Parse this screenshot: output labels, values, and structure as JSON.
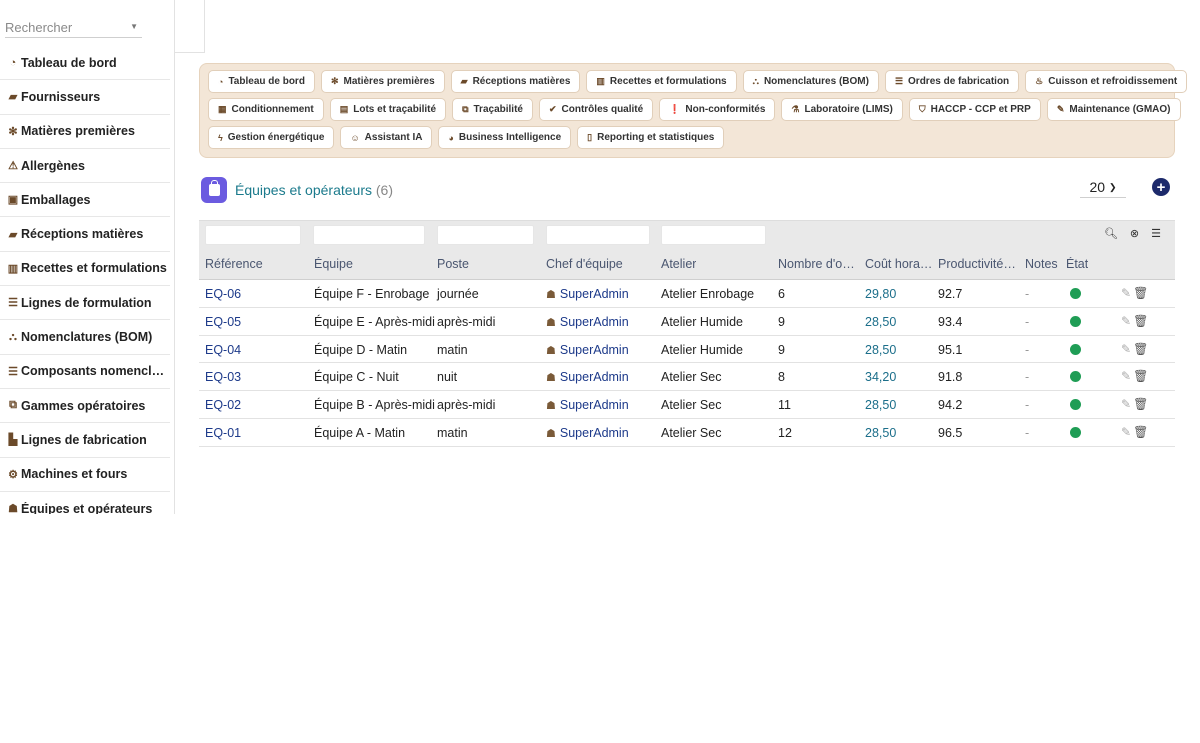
{
  "search": {
    "placeholder": "Rechercher"
  },
  "sidebar": {
    "items": [
      {
        "label": "Tableau de bord",
        "icon": "gauge-icon",
        "glyph": "◔"
      },
      {
        "label": "Fournisseurs",
        "icon": "truck-icon",
        "glyph": "▰"
      },
      {
        "label": "Matières premières",
        "icon": "seedling-icon",
        "glyph": "✻"
      },
      {
        "label": "Allergènes",
        "icon": "warning-icon",
        "glyph": "⚠"
      },
      {
        "label": "Emballages",
        "icon": "box-icon",
        "glyph": "▣"
      },
      {
        "label": "Réceptions matières",
        "icon": "truck-loading-icon",
        "glyph": "▰"
      },
      {
        "label": "Recettes et formulations",
        "icon": "book-icon",
        "glyph": "▥"
      },
      {
        "label": "Lignes de formulation",
        "icon": "list-icon",
        "glyph": "☰"
      },
      {
        "label": "Nomenclatures (BOM)",
        "icon": "sitemap-icon",
        "glyph": "⛬"
      },
      {
        "label": "Composants nomenclature",
        "icon": "list-icon",
        "glyph": "☰"
      },
      {
        "label": "Gammes opératoires",
        "icon": "project-diagram-icon",
        "glyph": "⧉"
      },
      {
        "label": "Lignes de fabrication",
        "icon": "industry-icon",
        "glyph": "▙"
      },
      {
        "label": "Machines et fours",
        "icon": "cogs-icon",
        "glyph": "⚙"
      },
      {
        "label": "Équipes et opérateurs",
        "icon": "users-icon",
        "glyph": "☗"
      }
    ]
  },
  "modules": {
    "rows": [
      [
        {
          "label": "Tableau de bord",
          "icon": "gauge-icon",
          "glyph": "◔"
        },
        {
          "label": "Matières premières",
          "icon": "seedling-icon",
          "glyph": "✻"
        },
        {
          "label": "Réceptions matières",
          "icon": "truck-loading-icon",
          "glyph": "▰"
        },
        {
          "label": "Recettes et formulations",
          "icon": "book-icon",
          "glyph": "▥"
        },
        {
          "label": "Nomenclatures (BOM)",
          "icon": "sitemap-icon",
          "glyph": "⛬"
        },
        {
          "label": "Ordres de fabrication",
          "icon": "list-icon",
          "glyph": "☰"
        },
        {
          "label": "Cuisson et refroidissement",
          "icon": "fire-icon",
          "glyph": "♨"
        }
      ],
      [
        {
          "label": "Conditionnement",
          "icon": "boxes-icon",
          "glyph": "▦"
        },
        {
          "label": "Lots et traçabilité",
          "icon": "barcode-icon",
          "glyph": "▤"
        },
        {
          "label": "Traçabilité",
          "icon": "project-diagram-icon",
          "glyph": "⧉"
        },
        {
          "label": "Contrôles qualité",
          "icon": "check-circle-icon",
          "glyph": "✔"
        },
        {
          "label": "Non-conformités",
          "icon": "exclamation-circle-icon",
          "glyph": "❗"
        },
        {
          "label": "Laboratoire (LIMS)",
          "icon": "flask-icon",
          "glyph": "⚗"
        },
        {
          "label": "HACCP - CCP et PRP",
          "icon": "shield-icon",
          "glyph": "⛉"
        },
        {
          "label": "Maintenance (GMAO)",
          "icon": "wrench-icon",
          "glyph": "✎"
        }
      ],
      [
        {
          "label": "Gestion énergétique",
          "icon": "bolt-icon",
          "glyph": "ϟ"
        },
        {
          "label": "Assistant IA",
          "icon": "robot-icon",
          "glyph": "☺"
        },
        {
          "label": "Business Intelligence",
          "icon": "chart-pie-icon",
          "glyph": "◕"
        },
        {
          "label": "Reporting et statistiques",
          "icon": "file-icon",
          "glyph": "▯"
        }
      ]
    ]
  },
  "page": {
    "title": "Équipes et opérateurs",
    "count": "(6)",
    "per_page": "20"
  },
  "table": {
    "columns": [
      "Référence",
      "Équipe",
      "Poste",
      "Chef d'équipe",
      "Atelier",
      "Nombre d'opérateurs",
      "Coût horaire",
      "Productivité cible",
      "Notes",
      "État"
    ],
    "rows": [
      {
        "ref": "EQ-06",
        "team": "Équipe F - Enrobage",
        "shift": "journée",
        "chief": "SuperAdmin",
        "workshop": "Atelier Enrobage",
        "operators": "6",
        "cost": "29,80",
        "productivity": "92.7",
        "notes": "-"
      },
      {
        "ref": "EQ-05",
        "team": "Équipe E - Après-midi",
        "shift": "après-midi",
        "chief": "SuperAdmin",
        "workshop": "Atelier Humide",
        "operators": "9",
        "cost": "28,50",
        "productivity": "93.4",
        "notes": "-"
      },
      {
        "ref": "EQ-04",
        "team": "Équipe D - Matin",
        "shift": "matin",
        "chief": "SuperAdmin",
        "workshop": "Atelier Humide",
        "operators": "9",
        "cost": "28,50",
        "productivity": "95.1",
        "notes": "-"
      },
      {
        "ref": "EQ-03",
        "team": "Équipe C - Nuit",
        "shift": "nuit",
        "chief": "SuperAdmin",
        "workshop": "Atelier Sec",
        "operators": "8",
        "cost": "34,20",
        "productivity": "91.8",
        "notes": "-"
      },
      {
        "ref": "EQ-02",
        "team": "Équipe B - Après-midi",
        "shift": "après-midi",
        "chief": "SuperAdmin",
        "workshop": "Atelier Sec",
        "operators": "11",
        "cost": "28,50",
        "productivity": "94.2",
        "notes": "-"
      },
      {
        "ref": "EQ-01",
        "team": "Équipe A - Matin",
        "shift": "matin",
        "chief": "SuperAdmin",
        "workshop": "Atelier Sec",
        "operators": "12",
        "cost": "28,50",
        "productivity": "96.5",
        "notes": "-"
      }
    ]
  },
  "colors": {
    "accent": "#1b7a8c",
    "link": "#1d3a8a",
    "status_ok": "#1f9d55",
    "module_panel": "#f3e6d7",
    "add_button": "#1d2a6b"
  }
}
